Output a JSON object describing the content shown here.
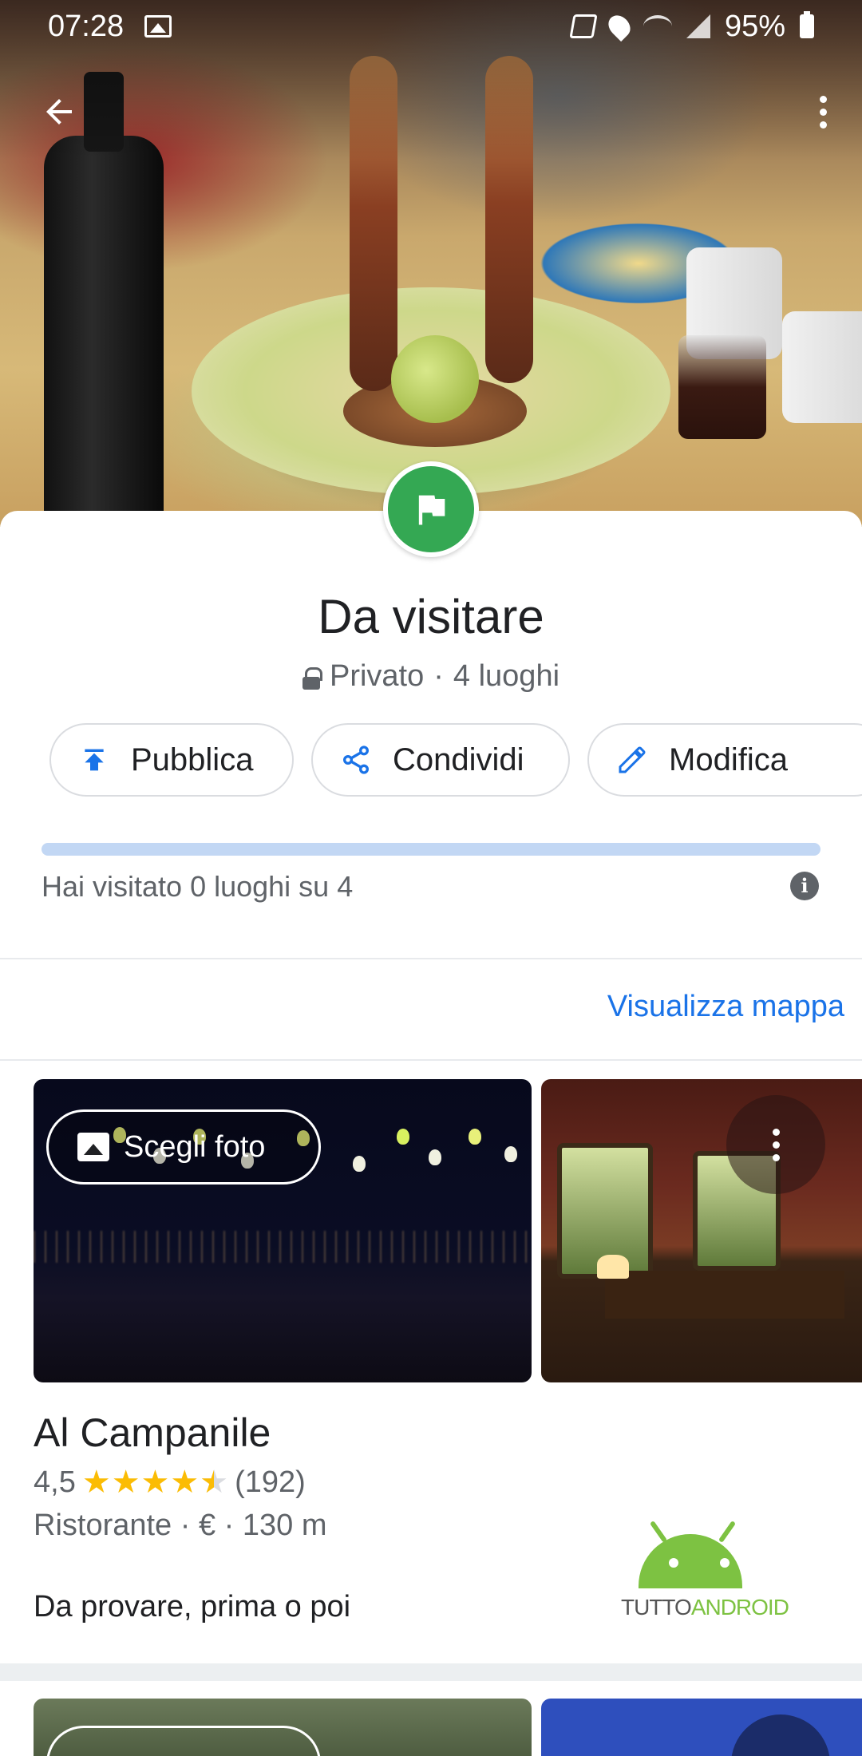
{
  "status_bar": {
    "time": "07:28",
    "battery": "95%",
    "icons": [
      "image-icon",
      "mute-icon",
      "location-icon",
      "wifi-icon",
      "signal-icon",
      "battery-icon"
    ]
  },
  "header": {
    "back_icon": "arrow-back-icon",
    "more_icon": "more-vert-icon"
  },
  "list": {
    "badge_icon": "flag-icon",
    "badge_color": "#34a853",
    "title": "Da visitare",
    "privacy": "Privato",
    "meta_sep": "·",
    "count": "4 luoghi"
  },
  "actions": [
    {
      "label": "Pubblica",
      "icon": "publish-icon"
    },
    {
      "label": "Condividi",
      "icon": "share-icon"
    },
    {
      "label": "Modifica",
      "icon": "edit-icon"
    }
  ],
  "progress": {
    "visited": 0,
    "total": 4,
    "text": "Hai visitato 0 luoghi su 4",
    "info_icon": "info-icon"
  },
  "map_link": "Visualizza mappa",
  "place": {
    "choose_photo": "Scegli foto",
    "name": "Al Campanile",
    "rating": "4,5",
    "stars": 4.5,
    "reviews": "(192)",
    "category": "Ristorante",
    "price": "€",
    "distance": "130 m",
    "type_line": "Ristorante · € · 130 m",
    "note": "Da provare, prima o poi"
  },
  "watermark": {
    "part1": "TUTTO",
    "part2": "ANDROID"
  },
  "colors": {
    "accent": "#1a73e8",
    "star": "#fbbc04",
    "progress_track": "#c2d7f4"
  }
}
